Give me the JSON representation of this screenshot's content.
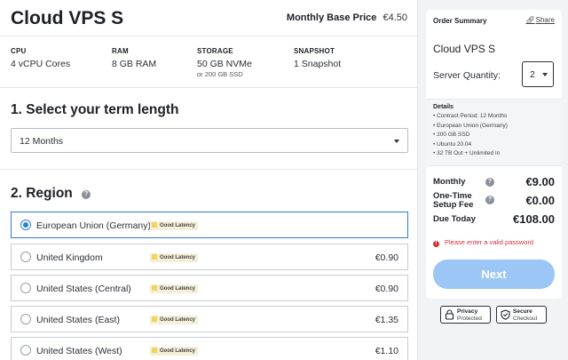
{
  "product": {
    "title": "Cloud VPS S",
    "base_price_label": "Monthly Base Price",
    "base_price": "€4.50",
    "specs": [
      {
        "key": "CPU",
        "value": "4 vCPU Cores",
        "sub": ""
      },
      {
        "key": "RAM",
        "value": "8 GB RAM",
        "sub": ""
      },
      {
        "key": "STORAGE",
        "value": "50 GB NVMe",
        "sub": "or 200 GB SSD"
      },
      {
        "key": "SNAPSHOT",
        "value": "1 Snapshot",
        "sub": ""
      }
    ]
  },
  "term": {
    "heading": "1. Select your term length",
    "selected": "12 Months"
  },
  "region": {
    "heading": "2. Region",
    "help_icon": "question-circle-icon",
    "badge_label": "Good Latency",
    "options": [
      {
        "name": "European Union (Germany)",
        "price": "",
        "selected": true
      },
      {
        "name": "United Kingdom",
        "price": "€0.90",
        "selected": false
      },
      {
        "name": "United States (Central)",
        "price": "€0.90",
        "selected": false
      },
      {
        "name": "United States (East)",
        "price": "€1.35",
        "selected": false
      },
      {
        "name": "United States (West)",
        "price": "€1.10",
        "selected": false
      }
    ]
  },
  "summary": {
    "title": "Order Summary",
    "share_label": "Share",
    "product": "Cloud VPS S",
    "quantity_label": "Server Quantity:",
    "quantity": "2",
    "details_title": "Details",
    "details": [
      "Contract Period: 12 Months",
      "European Union (Germany)",
      "200 GB SSD",
      "Ubuntu 20.04",
      "32 TB Out + Unlimited In"
    ],
    "monthly_label": "Monthly",
    "monthly": "€9.00",
    "setup_label": "One-Time Setup Fee",
    "setup": "€0.00",
    "due_label": "Due Today",
    "due": "€108.00",
    "error": "Please enter a valid password",
    "next_label": "Next"
  },
  "trust": [
    {
      "line1": "Privacy",
      "line2": "Protected",
      "icon": "lock-icon"
    },
    {
      "line1": "Secure",
      "line2": "Checkout",
      "icon": "shield-check-icon"
    }
  ],
  "colors": {
    "accent": "#2f7bd8",
    "button_disabled": "#9cc6f5",
    "error": "#d4303a",
    "badge_yellow": "#f3d55b"
  }
}
